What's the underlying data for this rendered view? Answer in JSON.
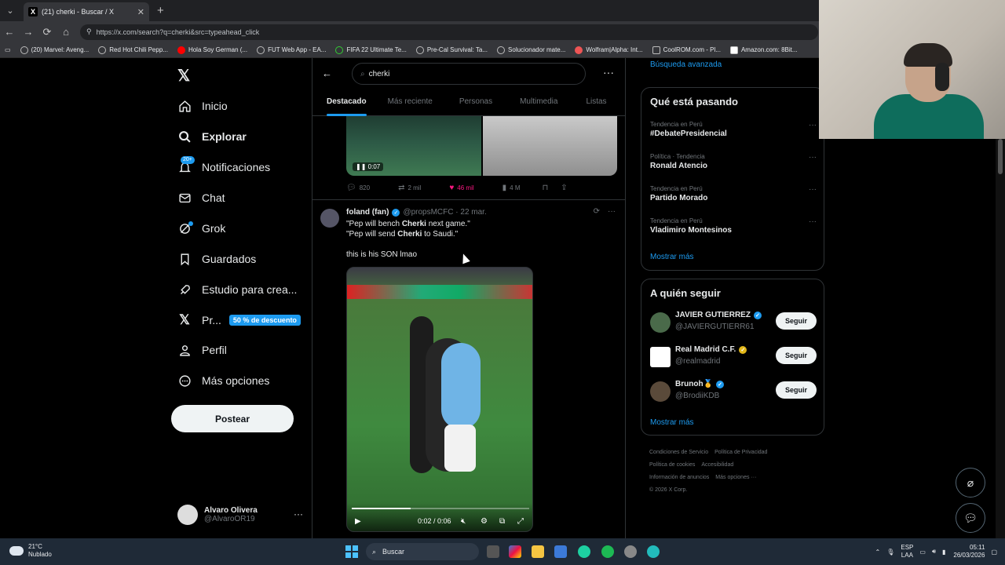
{
  "browser": {
    "tab_title": "(21) cherki - Buscar / X",
    "url": "https://x.com/search?q=cherki&src=typeahead_click",
    "bookmarks": [
      "(20) Marvel: Aveng...",
      "Red Hot Chili Pepp...",
      "Hola Soy German (...",
      "FUT Web App - EA...",
      "FIFA 22 Ultimate Te...",
      "Pre-Cal Survival: Ta...",
      "Solucionador mate...",
      "Wolfram|Alpha: Int...",
      "CoolROM.com - Pl...",
      "Amazon.com: 8Bit..."
    ]
  },
  "leftnav": {
    "items": [
      {
        "label": "Inicio"
      },
      {
        "label": "Explorar"
      },
      {
        "label": "Notificaciones",
        "badge": "20+"
      },
      {
        "label": "Chat"
      },
      {
        "label": "Grok"
      },
      {
        "label": "Guardados"
      },
      {
        "label": "Estudio para crea..."
      },
      {
        "label": "Pr...",
        "badge": "50 % de descuento"
      },
      {
        "label": "Perfil"
      },
      {
        "label": "Más opciones"
      }
    ],
    "post_label": "Postear",
    "account": {
      "name": "Alvaro Olivera",
      "handle": "@AlvaroOR19"
    }
  },
  "search": {
    "query": "cherki",
    "tabs": [
      "Destacado",
      "Más reciente",
      "Personas",
      "Multimedia",
      "Listas"
    ],
    "prev_video_time": "0:07",
    "prev_stats": {
      "replies": "820",
      "reposts": "2 mil",
      "likes": "46 mil",
      "views": "4 M"
    }
  },
  "tweet": {
    "name": "foland (fan)",
    "handle": "@propsMCFC",
    "date": "22 mar.",
    "line1_pre": "\"Pep will bench ",
    "line1_bold": "Cherki",
    "line1_post": " next game.\"",
    "line2_pre": "\"Pep will send ",
    "line2_bold": "Cherki",
    "line2_post": " to Saudi.\"",
    "line3": "this is his SON lmao",
    "video_time": "0:02 / 0:06",
    "video_progress": 0.33
  },
  "right": {
    "advanced_search": "Búsqueda avanzada",
    "trends_title": "Qué está pasando",
    "trends": [
      {
        "context": "Tendencia en Perú",
        "name": "#DebatePresidencial"
      },
      {
        "context": "Política · Tendencia",
        "name": "Ronald Atencio"
      },
      {
        "context": "Tendencia en Perú",
        "name": "Partido Morado"
      },
      {
        "context": "Tendencia en Perú",
        "name": "Vladimiro Montesinos"
      }
    ],
    "show_more": "Mostrar más",
    "follow_title": "A quién seguir",
    "follow": [
      {
        "name": "JAVIER GUTIERREZ",
        "handle": "@JAVIERGUTIERR61"
      },
      {
        "name": "Real Madrid C.F.",
        "handle": "@realmadrid"
      },
      {
        "name": "Brunoh🥇",
        "handle": "@BrodiiKDB"
      }
    ],
    "follow_label": "Seguir",
    "footer": [
      "Condiciones de Servicio",
      "Política de Privacidad",
      "Política de cookies",
      "Accesibilidad",
      "Información de anuncios",
      "Más opciones ···",
      "© 2026 X Corp."
    ]
  },
  "taskbar": {
    "temp": "21°C",
    "weather": "Nublado",
    "search": "Buscar",
    "lang1": "ESP",
    "lang2": "LAA",
    "time": "05:11",
    "date": "26/03/2026"
  }
}
